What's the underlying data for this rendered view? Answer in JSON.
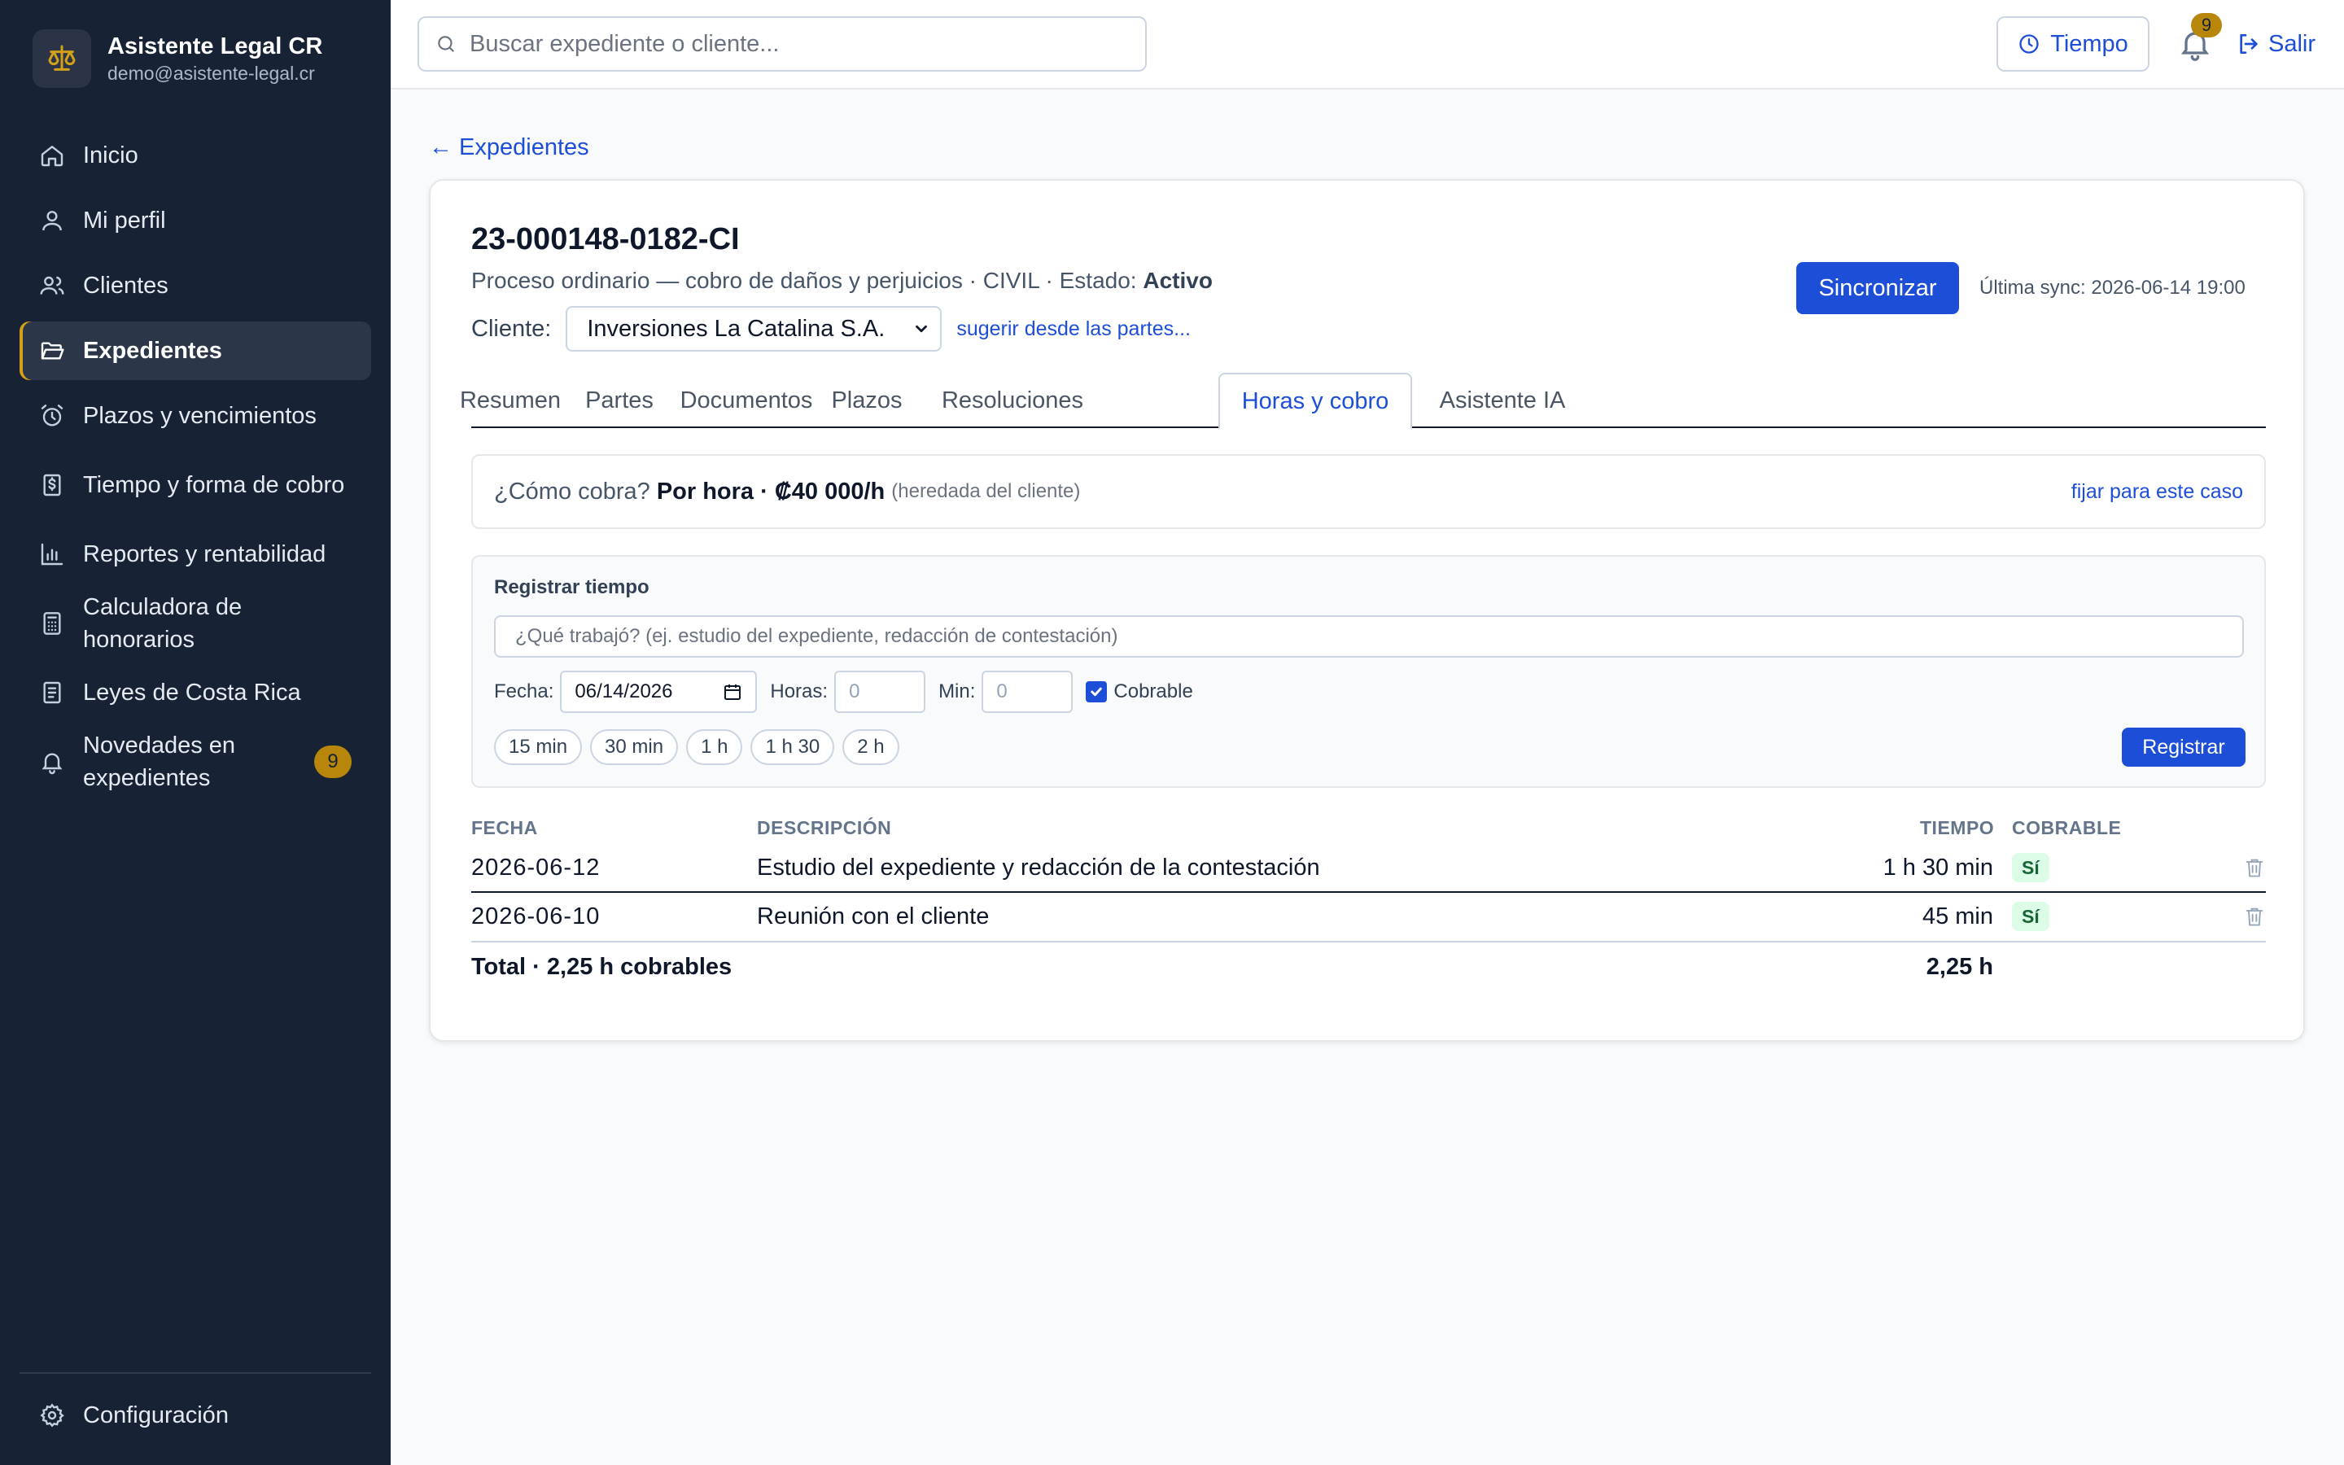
{
  "app": {
    "name": "Asistente Legal CR",
    "email": "demo@asistente-legal.cr"
  },
  "sidebar": {
    "items": [
      {
        "label": "Inicio",
        "icon": "home-icon"
      },
      {
        "label": "Mi perfil",
        "icon": "user-icon"
      },
      {
        "label": "Clientes",
        "icon": "users-icon"
      },
      {
        "label": "Expedientes",
        "icon": "folder-open-icon",
        "active": true
      },
      {
        "label": "Plazos y vencimientos",
        "icon": "alarm-clock-icon"
      },
      {
        "label": "Tiempo y forma de cobro",
        "icon": "receipt-dollar-icon"
      },
      {
        "label": "Reportes y rentabilidad",
        "icon": "bar-chart-icon"
      },
      {
        "label": "Calculadora de honorarios",
        "icon": "calculator-icon"
      },
      {
        "label": "Leyes de Costa Rica",
        "icon": "book-icon"
      },
      {
        "label": "Novedades en expedientes",
        "icon": "bell-icon",
        "badge": "9"
      }
    ],
    "settings_label": "Configuración"
  },
  "topbar": {
    "search_placeholder": "Buscar expediente o cliente...",
    "tiempo_label": "Tiempo",
    "notifications_count": "9",
    "logout_label": "Salir"
  },
  "breadcrumb": {
    "back_label": "← Expedientes"
  },
  "case": {
    "number": "23-000148-0182-CI",
    "description": "Proceso ordinario — cobro de daños y perjuicios · CIVIL · Estado: ",
    "status": "Activo",
    "client_label": "Cliente:",
    "client_value": "Inversiones La Catalina S.A.",
    "suggest_link": "sugerir desde las partes...",
    "sync_button": "Sincronizar",
    "last_sync": "Última sync: 2026-06-14 19:00"
  },
  "tabs": [
    {
      "label": "Resumen"
    },
    {
      "label": "Partes"
    },
    {
      "label": "Documentos"
    },
    {
      "label": "Plazos"
    },
    {
      "label": "Resoluciones"
    },
    {
      "label": "Horas y cobro",
      "active": true
    },
    {
      "label": "Asistente IA"
    }
  ],
  "billing": {
    "question": "¿Cómo cobra?",
    "rate": "Por hora · ₡40 000/h",
    "inherited": "(heredada del cliente)",
    "set_link": "fijar para este caso"
  },
  "register": {
    "title": "Registrar tiempo",
    "description_placeholder": "¿Qué trabajó? (ej. estudio del expediente, redacción de contestación)",
    "date_label": "Fecha:",
    "date_value": "06/14/2026",
    "hours_label": "Horas:",
    "hours_placeholder": "0",
    "minutes_label": "Min:",
    "minutes_placeholder": "0",
    "billable_label": "Cobrable",
    "billable_checked": true,
    "quick_chips": [
      "15 min",
      "30 min",
      "1 h",
      "1 h 30",
      "2 h"
    ],
    "submit_label": "Registrar"
  },
  "entries_table": {
    "headers": {
      "date": "FECHA",
      "description": "DESCRIPCIÓN",
      "time": "TIEMPO",
      "billable": "COBRABLE"
    },
    "rows": [
      {
        "date": "2026-06-12",
        "description": "Estudio del expediente y redacción de la contestación",
        "time": "1 h 30 min",
        "billable": "Sí"
      },
      {
        "date": "2026-06-10",
        "description": "Reunión con el cliente",
        "time": "45 min",
        "billable": "Sí"
      }
    ],
    "total_label": "Total · 2,25 h cobrables",
    "total_value": "2,25 h"
  },
  "colors": {
    "sidebar_bg": "#172235",
    "accent": "#1d4ed8",
    "badge": "#b8860b",
    "billable_bg": "#dcfce7"
  }
}
